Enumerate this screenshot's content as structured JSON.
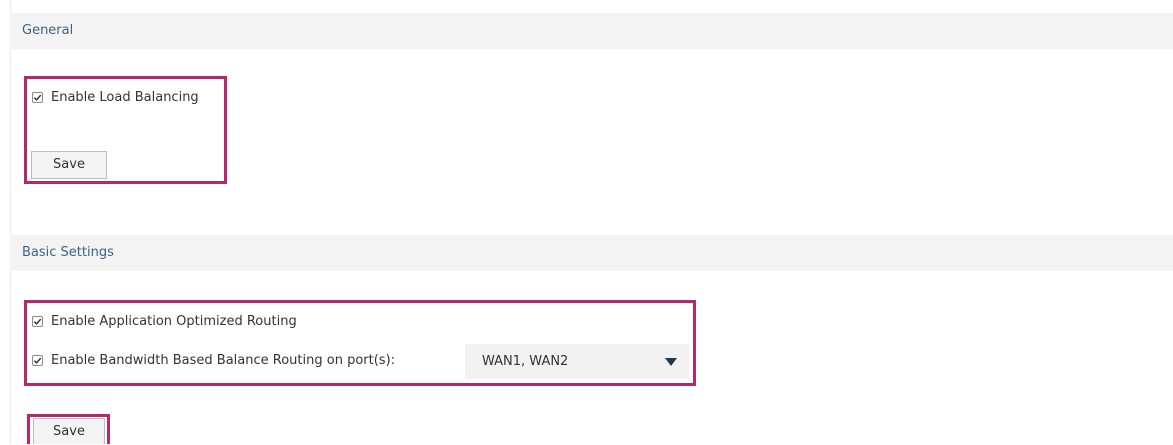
{
  "general": {
    "title": "General",
    "enable_load_balancing": {
      "label": "Enable Load Balancing",
      "checked": true
    },
    "save_label": "Save"
  },
  "basic_settings": {
    "title": "Basic Settings",
    "enable_app_optimized_routing": {
      "label": "Enable Application Optimized Routing",
      "checked": true
    },
    "enable_bandwidth_routing": {
      "label": "Enable Bandwidth Based Balance Routing on port(s):",
      "checked": true
    },
    "ports_select": {
      "value": "WAN1, WAN2"
    },
    "save_label": "Save"
  },
  "colors": {
    "highlight": "#b5276e",
    "header_bg": "#f3f3f3",
    "header_text": "#3d6480"
  },
  "icons": [
    "checkmark-icon",
    "dropdown-arrow-icon"
  ]
}
